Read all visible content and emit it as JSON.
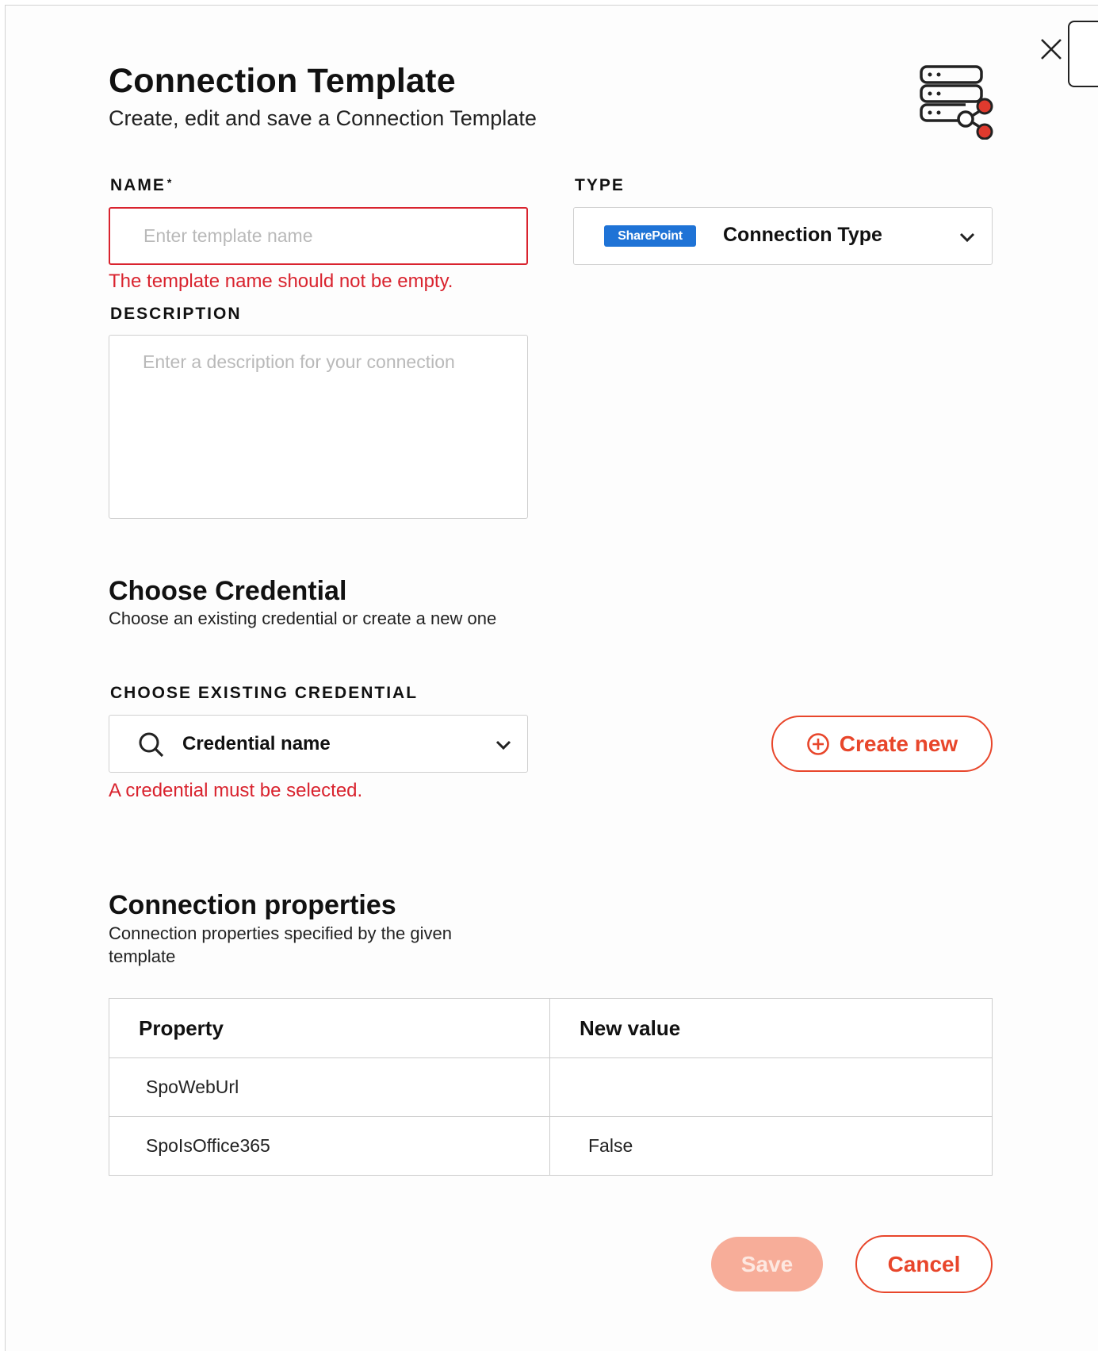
{
  "header": {
    "title": "Connection Template",
    "subtitle": "Create, edit and save a Connection Template",
    "icon": "server-share-icon"
  },
  "form": {
    "name_label": "NAME",
    "name_required_marker": "*",
    "name_placeholder": "Enter template name",
    "name_value": "",
    "name_error": "The template name should not be empty.",
    "type_label": "TYPE",
    "type_badge": "SharePoint",
    "type_value": "Connection Type",
    "description_label": "DESCRIPTION",
    "description_placeholder": "Enter a description for your connection",
    "description_value": ""
  },
  "credential": {
    "section_title": "Choose Credential",
    "section_subtitle": "Choose an existing credential or create a new one",
    "existing_label": "CHOOSE EXISTING CREDENTIAL",
    "select_value": "Credential name",
    "error": "A credential must be selected.",
    "create_new_label": "Create new"
  },
  "properties": {
    "section_title": "Connection properties",
    "section_subtitle": "Connection properties specified by the given template",
    "columns": [
      "Property",
      "New value"
    ],
    "rows": [
      [
        "SpoWebUrl",
        ""
      ],
      [
        "SpoIsOffice365",
        "False"
      ]
    ]
  },
  "actions": {
    "save_label": "Save",
    "cancel_label": "Cancel"
  },
  "colors": {
    "accent": "#e8462b",
    "error": "#d9232e",
    "save_disabled": "#f7ad99",
    "sharepoint_badge": "#1f73d6"
  }
}
